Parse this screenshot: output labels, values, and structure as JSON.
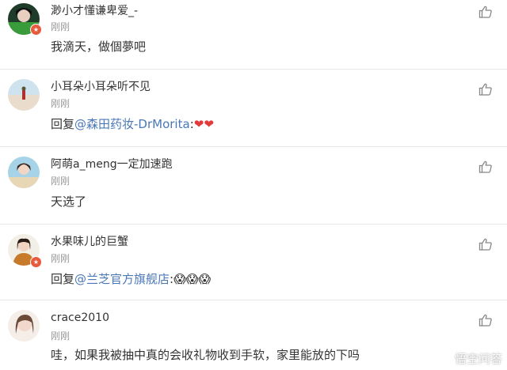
{
  "comments": [
    {
      "username": "渺小才懂谦卑爱_-",
      "time": "刚刚",
      "text": "我滴天，做個夢吧",
      "verified": true
    },
    {
      "username": "小耳朵小耳朵听不见",
      "time": "刚刚",
      "reply_prefix": "回复",
      "mention": "@森田药妆-DrMorita",
      "suffix": ":",
      "emoji": "❤❤",
      "verified": false
    },
    {
      "username": "阿萌a_meng一定加速跑",
      "time": "刚刚",
      "text": "天选了",
      "verified": false
    },
    {
      "username": "水果味儿的巨蟹",
      "time": "刚刚",
      "reply_prefix": "回复",
      "mention": "@兰芝官方旗舰店",
      "suffix": ":",
      "emoji": "😱😱😱",
      "verified": true
    },
    {
      "username": "crace2010",
      "time": "刚刚",
      "text": "哇，如果我被抽中真的会收礼物收到手软，家里能放的下吗",
      "verified": false
    }
  ],
  "icons": {
    "like": "thumbs-up-icon",
    "verified": "verified-badge-icon"
  },
  "colors": {
    "mention": "#4a78b7",
    "time": "#999999",
    "divider": "#e6e6e6",
    "badge": "#e85a3c"
  },
  "watermark": {
    "text": "悟空问答"
  }
}
